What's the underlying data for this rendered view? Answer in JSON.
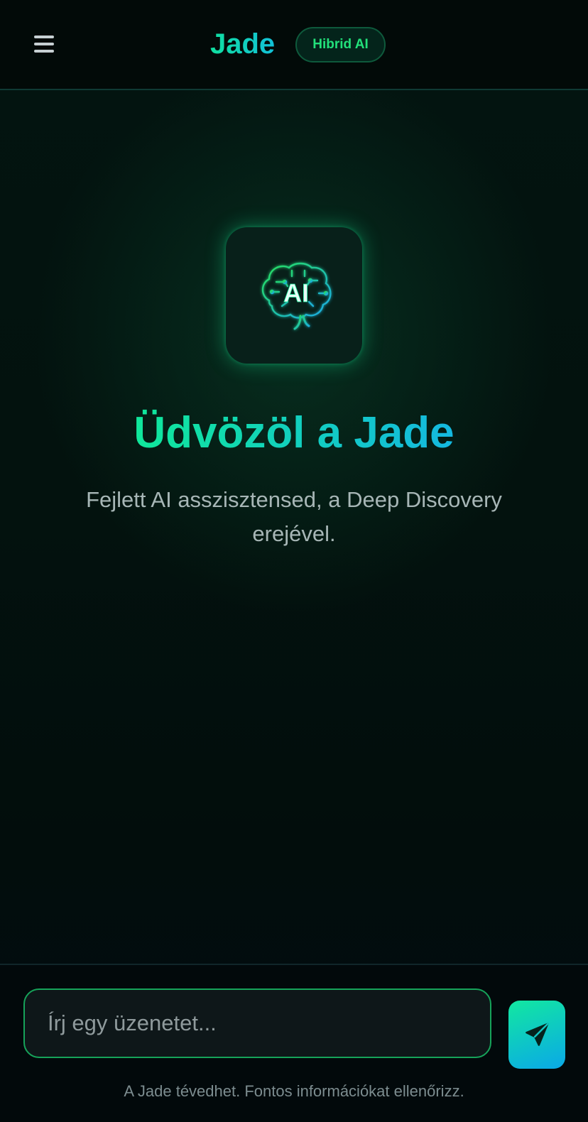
{
  "header": {
    "brand": "Jade",
    "badge": "Hibrid AI",
    "menu_icon": "menu-icon"
  },
  "hero": {
    "logo_text": "AI",
    "logo_icon": "brain-icon",
    "welcome": "Üdvözöl a Jade",
    "subtitle": "Fejlett AI asszisztensed, a Deep Discovery erejével."
  },
  "composer": {
    "placeholder": "Írj egy üzenetet...",
    "send_icon": "send-icon",
    "disclaimer": "A Jade tévedhet. Fontos információkat ellenőrizz."
  },
  "colors": {
    "accent_green": "#10e89a",
    "accent_cyan": "#14b8e0",
    "badge_text": "#22e07a",
    "input_border": "#16a35a",
    "background": "#03100c"
  }
}
